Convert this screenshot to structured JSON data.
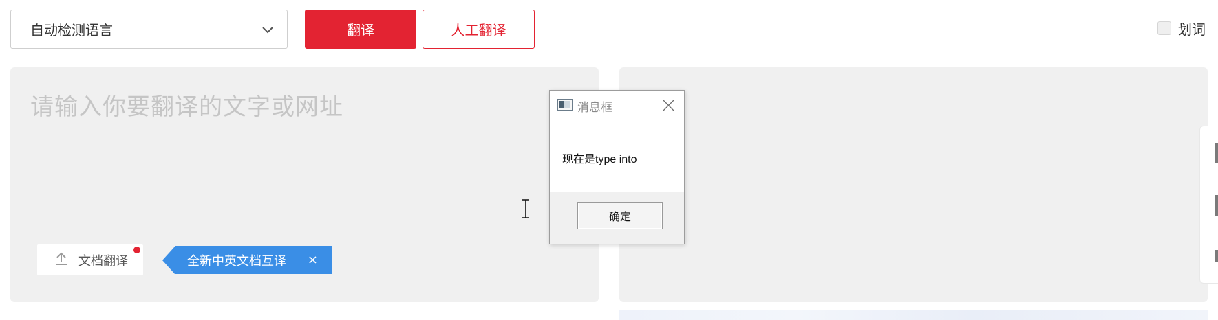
{
  "toolbar": {
    "language_select": "自动检测语言",
    "translate_button": "翻译",
    "human_translate_button": "人工翻译",
    "word_select_label": "划词",
    "word_select_checked": false
  },
  "source_panel": {
    "placeholder": "请输入你要翻译的文字或网址",
    "doc_translate_button": "文档翻译",
    "promo_label": "全新中英文档互译",
    "promo_close": "×"
  },
  "dialog": {
    "title": "消息框",
    "message": "现在是type into",
    "ok_button": "确定"
  },
  "colors": {
    "brand_red": "#e32332",
    "promo_blue": "#3a8ee6",
    "panel_bg": "#f0f0f0"
  },
  "icons": {
    "chevron": "chevron-down-icon",
    "upload": "upload-icon",
    "dialog_app": "window-icon",
    "dialog_close": "close-icon"
  }
}
